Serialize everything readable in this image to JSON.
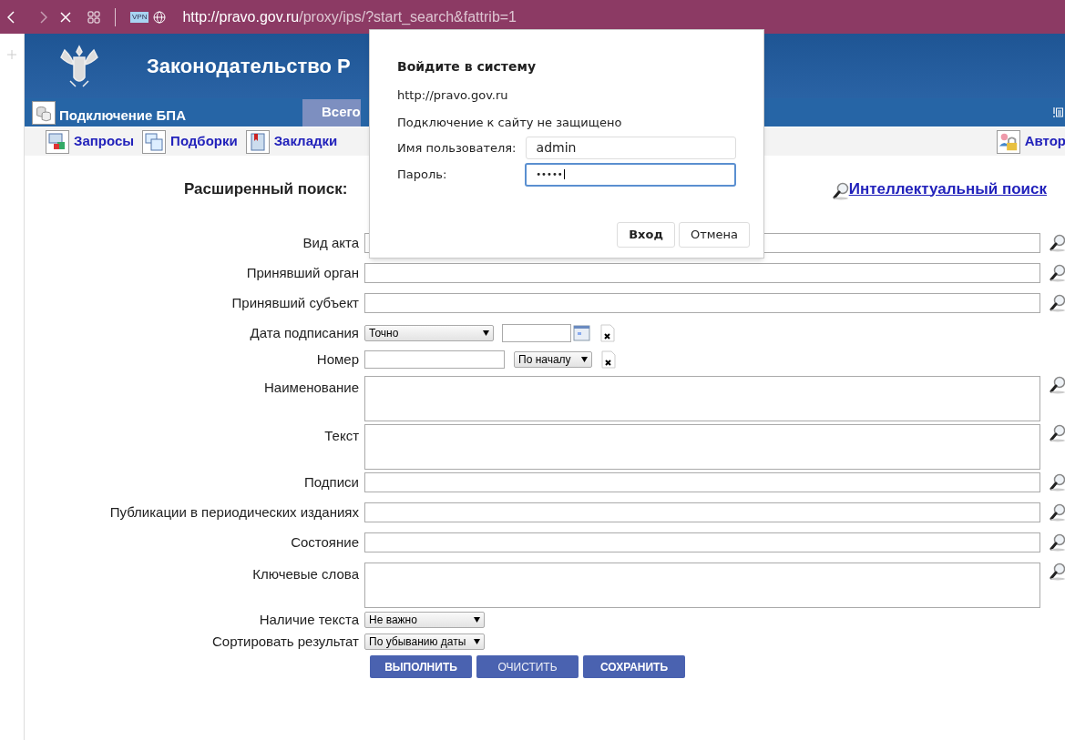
{
  "browser": {
    "url_host": "http://pravo.gov.ru",
    "url_path": "/proxy/ips/?start_search&fattrib=1",
    "vpn_badge": "VPN"
  },
  "header": {
    "title": "Законодательство Р",
    "connection": "Подключение БПА",
    "tab": "Всего"
  },
  "toolbar": [
    {
      "label": "Запросы"
    },
    {
      "label": "Подборки"
    },
    {
      "label": "Закладки"
    }
  ],
  "auth_link": "Автор",
  "search": {
    "title": "Расширенный поиск:",
    "smart_link": "Интеллектуальный поиск",
    "fields": [
      {
        "label": "Вид акта",
        "kind": "text"
      },
      {
        "label": "Принявший орган",
        "kind": "text"
      },
      {
        "label": "Принявший субъект",
        "kind": "text"
      },
      {
        "label": "Дата подписания",
        "kind": "date",
        "mode": "Точно"
      },
      {
        "label": "Номер",
        "kind": "number",
        "mode": "По началу"
      },
      {
        "label": "Наименование",
        "kind": "textarea"
      },
      {
        "label": "Текст",
        "kind": "textarea"
      },
      {
        "label": "Подписи",
        "kind": "text"
      },
      {
        "label": "Публикации в периодических изданиях",
        "kind": "text"
      },
      {
        "label": "Состояние",
        "kind": "text"
      },
      {
        "label": "Ключевые слова",
        "kind": "textarea"
      },
      {
        "label": "Наличие текста",
        "kind": "select",
        "value": "Не важно"
      },
      {
        "label": "Сортировать результат",
        "kind": "select",
        "value": "По убыванию даты"
      }
    ],
    "buttons": [
      {
        "label": "ВЫПОЛНИТЬ",
        "disabled": false
      },
      {
        "label": "ОЧИСТИТЬ",
        "disabled": true
      },
      {
        "label": "СОХРАНИТЬ",
        "disabled": false
      }
    ]
  },
  "dialog": {
    "title": "Войдите в систему",
    "site": "http://pravo.gov.ru",
    "warning": "Подключение к сайту не защищено",
    "username_label": "Имя пользователя:",
    "username": "admin",
    "password_label": "Пароль:",
    "password": "•••••",
    "buttons": [
      {
        "label": "Вход",
        "default": true
      },
      {
        "label": "Отмена",
        "default": false
      }
    ]
  }
}
